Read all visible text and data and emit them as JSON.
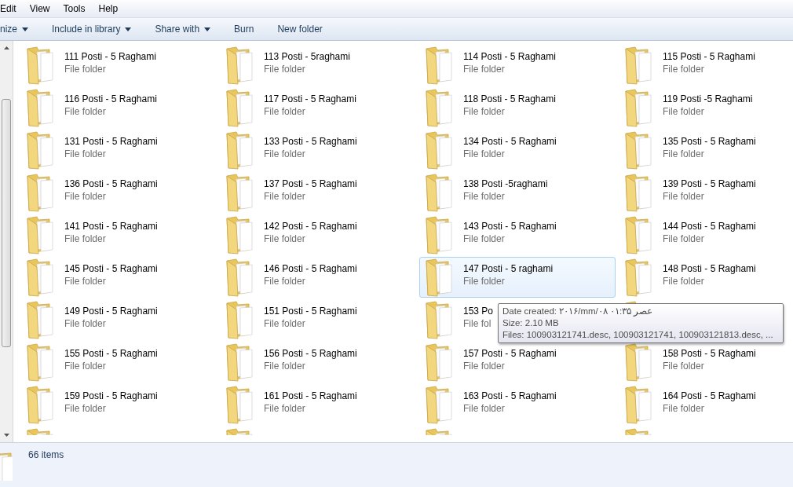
{
  "menu_bar": [
    "Edit",
    "View",
    "Tools",
    "Help"
  ],
  "toolbar": [
    {
      "label": "nize",
      "dropdown": true
    },
    {
      "label": "Include in library",
      "dropdown": true
    },
    {
      "label": "Share with",
      "dropdown": true
    },
    {
      "label": "Burn",
      "dropdown": false
    },
    {
      "label": "New folder",
      "dropdown": false
    }
  ],
  "items": [
    {
      "name": "111 Posti - 5 Raghami",
      "type": "File folder",
      "selected": false
    },
    {
      "name": "113 Posti - 5raghami",
      "type": "File folder",
      "selected": false
    },
    {
      "name": "114 Posti - 5 Raghami",
      "type": "File folder",
      "selected": false
    },
    {
      "name": "115 Posti - 5 Raghami",
      "type": "File folder",
      "selected": false
    },
    {
      "name": "116 Posti - 5 Raghami",
      "type": "File folder",
      "selected": false
    },
    {
      "name": "117 Posti - 5 Raghami",
      "type": "File folder",
      "selected": false
    },
    {
      "name": "118 Posti - 5 Raghami",
      "type": "File folder",
      "selected": false
    },
    {
      "name": "119 Posti -5 Raghami",
      "type": "File folder",
      "selected": false
    },
    {
      "name": "131 Posti - 5 Raghami",
      "type": "File folder",
      "selected": false
    },
    {
      "name": "133 Posti - 5 Raghami",
      "type": "File folder",
      "selected": false
    },
    {
      "name": "134 Posti - 5 Raghami",
      "type": "File folder",
      "selected": false
    },
    {
      "name": "135 Posti - 5 Raghami",
      "type": "File folder",
      "selected": false
    },
    {
      "name": "136 Posti - 5 Raghami",
      "type": "File folder",
      "selected": false
    },
    {
      "name": "137 Posti - 5 Raghami",
      "type": "File folder",
      "selected": false
    },
    {
      "name": "138 Posti -5raghami",
      "type": "File folder",
      "selected": false
    },
    {
      "name": "139 Posti - 5 Raghami",
      "type": "File folder",
      "selected": false
    },
    {
      "name": "141 Posti - 5 Raghami",
      "type": "File folder",
      "selected": false
    },
    {
      "name": "142 Posti - 5 Raghami",
      "type": "File folder",
      "selected": false
    },
    {
      "name": "143 Posti - 5 Raghami",
      "type": "File folder",
      "selected": false
    },
    {
      "name": "144 Posti - 5 Raghami",
      "type": "File folder",
      "selected": false
    },
    {
      "name": "145 Posti - 5 Raghami",
      "type": "File folder",
      "selected": false
    },
    {
      "name": "146 Posti - 5 Raghami",
      "type": "File folder",
      "selected": false
    },
    {
      "name": "147 Posti - 5 raghami",
      "type": "File folder",
      "selected": true
    },
    {
      "name": "148 Posti - 5 Raghami",
      "type": "File folder",
      "selected": false
    },
    {
      "name": "149 Posti - 5 Raghami",
      "type": "File folder",
      "selected": false
    },
    {
      "name": "151 Posti - 5 Raghami",
      "type": "File folder",
      "selected": false
    },
    {
      "name": "153 Po",
      "type": "File fol",
      "selected": false
    },
    {
      "selected": false
    },
    {
      "name": "155 Posti - 5 Raghami",
      "type": "File folder",
      "selected": false
    },
    {
      "name": "156 Posti - 5 Raghami",
      "type": "File folder",
      "selected": false
    },
    {
      "name": "157 Posti - 5 Raghami",
      "type": "File folder",
      "selected": false
    },
    {
      "name": "158 Posti - 5 Raghami",
      "type": "File folder",
      "selected": false
    },
    {
      "name": "159 Posti - 5 Raghami",
      "type": "File folder",
      "selected": false
    },
    {
      "name": "161 Posti - 5 Raghami",
      "type": "File folder",
      "selected": false
    },
    {
      "name": "163 Posti - 5 Raghami",
      "type": "File folder",
      "selected": false
    },
    {
      "name": "164 Posti - 5 Raghami",
      "type": "File folder",
      "selected": false
    }
  ],
  "tooltip": [
    "Date created: ۲۰۱۶/mm/۰۸ عصر ۰۱:۳۵",
    "Size: 2.10 MB",
    "Files: 100903121741.desc, 100903121741, 100903121813.desc, ..."
  ],
  "status_bar": {
    "count": "66 items"
  }
}
